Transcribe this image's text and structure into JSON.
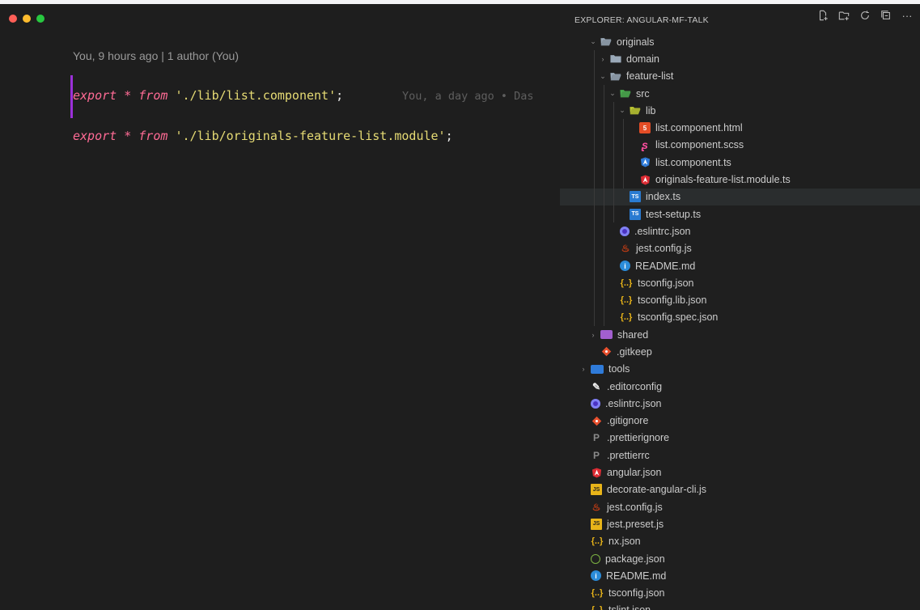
{
  "editor": {
    "codelens": "You, 9 hours ago | 1 author (You)",
    "line1": {
      "kw1": "export",
      "op": " * ",
      "kw2": "from",
      "sp": " ",
      "str": "'./lib/list.component'",
      "semi": ";"
    },
    "blame": "You, a day ago • Das",
    "line2": {
      "kw1": "export",
      "op": " * ",
      "kw2": "from",
      "sp": " ",
      "str": "'./lib/originals-feature-list.module'",
      "semi": ";"
    }
  },
  "explorer": {
    "title": "EXPLORER: ANGULAR-MF-TALK",
    "actions": [
      "new-file-icon",
      "new-folder-icon",
      "refresh-icon",
      "collapse-all-icon",
      "more-icon"
    ],
    "more_glyph": "···",
    "items": [
      {
        "label": "originals",
        "depth": 1,
        "chev": "open",
        "icon": "folder-open",
        "color": "#9aa9b8"
      },
      {
        "label": "domain",
        "depth": 2,
        "chev": "closed",
        "icon": "folder",
        "color": "#9aa9b8"
      },
      {
        "label": "feature-list",
        "depth": 2,
        "chev": "open",
        "icon": "folder-open",
        "color": "#9aa9b8"
      },
      {
        "label": "src",
        "depth": 3,
        "chev": "open",
        "icon": "folder-open",
        "color": "#4caf50"
      },
      {
        "label": "lib",
        "depth": 4,
        "chev": "open",
        "icon": "folder-open",
        "color": "#c0ca33"
      },
      {
        "label": "list.component.html",
        "depth": 5,
        "icon": "html"
      },
      {
        "label": "list.component.scss",
        "depth": 5,
        "icon": "scss"
      },
      {
        "label": "list.component.ts",
        "depth": 5,
        "icon": "angular-blue"
      },
      {
        "label": "originals-feature-list.module.ts",
        "depth": 5,
        "icon": "angular-red"
      },
      {
        "label": "index.ts",
        "depth": 4,
        "icon": "ts",
        "selected": true
      },
      {
        "label": "test-setup.ts",
        "depth": 4,
        "icon": "ts"
      },
      {
        "label": ".eslintrc.json",
        "depth": 3,
        "icon": "eslint"
      },
      {
        "label": "jest.config.js",
        "depth": 3,
        "icon": "jest"
      },
      {
        "label": "README.md",
        "depth": 3,
        "icon": "info"
      },
      {
        "label": "tsconfig.json",
        "depth": 3,
        "icon": "json"
      },
      {
        "label": "tsconfig.lib.json",
        "depth": 3,
        "icon": "json"
      },
      {
        "label": "tsconfig.spec.json",
        "depth": 3,
        "icon": "json"
      },
      {
        "label": "shared",
        "depth": 1,
        "chev": "closed",
        "icon": "shared"
      },
      {
        "label": ".gitkeep",
        "depth": 1,
        "icon": "git"
      },
      {
        "label": "tools",
        "depth": 0,
        "chev": "closed",
        "icon": "tools"
      },
      {
        "label": ".editorconfig",
        "depth": 0,
        "icon": "editorconfig"
      },
      {
        "label": ".eslintrc.json",
        "depth": 0,
        "icon": "eslint"
      },
      {
        "label": ".gitignore",
        "depth": 0,
        "icon": "git"
      },
      {
        "label": ".prettierignore",
        "depth": 0,
        "icon": "prettier"
      },
      {
        "label": ".prettierrc",
        "depth": 0,
        "icon": "prettier"
      },
      {
        "label": "angular.json",
        "depth": 0,
        "icon": "angular-red"
      },
      {
        "label": "decorate-angular-cli.js",
        "depth": 0,
        "icon": "js"
      },
      {
        "label": "jest.config.js",
        "depth": 0,
        "icon": "jest"
      },
      {
        "label": "jest.preset.js",
        "depth": 0,
        "icon": "js"
      },
      {
        "label": "nx.json",
        "depth": 0,
        "icon": "json"
      },
      {
        "label": "package.json",
        "depth": 0,
        "icon": "package"
      },
      {
        "label": "README.md",
        "depth": 0,
        "icon": "info"
      },
      {
        "label": "tsconfig.json",
        "depth": 0,
        "icon": "json"
      },
      {
        "label": "tslint.json",
        "depth": 0,
        "icon": "json"
      }
    ]
  }
}
